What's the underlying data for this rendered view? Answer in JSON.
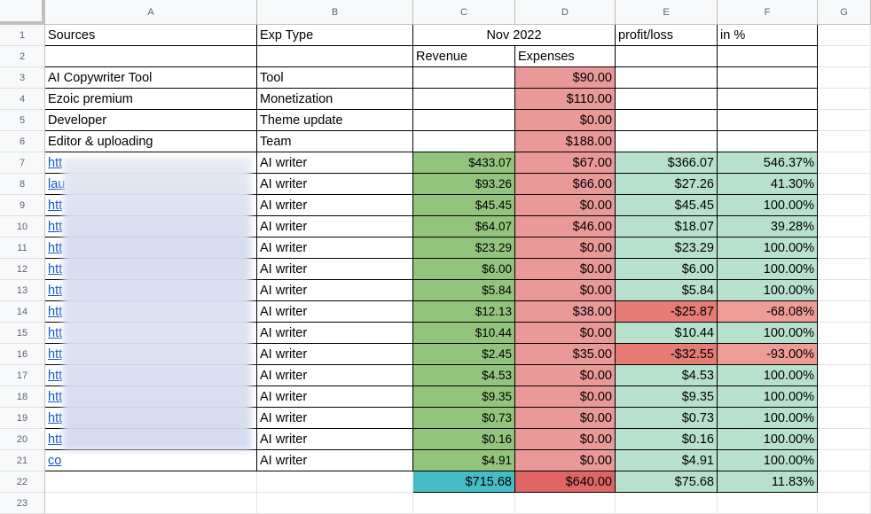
{
  "columns": [
    "A",
    "B",
    "C",
    "D",
    "E",
    "F",
    "G"
  ],
  "row_numbers": [
    "1",
    "2",
    "3",
    "4",
    "5",
    "6",
    "7",
    "8",
    "9",
    "10",
    "11",
    "12",
    "13",
    "14",
    "15",
    "16",
    "17",
    "18",
    "19",
    "20",
    "21",
    "22",
    "23"
  ],
  "header": {
    "sources": "Sources",
    "exp_type": "Exp Type",
    "period": "Nov 2022",
    "profit_loss": "profit/loss",
    "in_pct": "in %",
    "revenue": "Revenue",
    "expenses": "Expenses"
  },
  "rows": [
    {
      "a": "AI Copywriter Tool",
      "b": "Tool",
      "c": "",
      "d": "$90.00",
      "e": "",
      "f": ""
    },
    {
      "a": "Ezoic premium",
      "b": "Monetization",
      "c": "",
      "d": "$110.00",
      "e": "",
      "f": ""
    },
    {
      "a": "Developer",
      "b": "Theme update",
      "c": "",
      "d": "$0.00",
      "e": "",
      "f": ""
    },
    {
      "a": "Editor & uploading",
      "b": "Team",
      "c": "",
      "d": "$188.00",
      "e": "",
      "f": ""
    },
    {
      "a": "htt",
      "b": "AI writer",
      "c": "$433.07",
      "d": "$67.00",
      "e": "$366.07",
      "f": "546.37%"
    },
    {
      "a": "lau",
      "b": "AI writer",
      "c": "$93.26",
      "d": "$66.00",
      "e": "$27.26",
      "f": "41.30%"
    },
    {
      "a": "htt",
      "b": "AI writer",
      "c": "$45.45",
      "d": "$0.00",
      "e": "$45.45",
      "f": "100.00%"
    },
    {
      "a": "htt",
      "b": "AI writer",
      "c": "$64.07",
      "d": "$46.00",
      "e": "$18.07",
      "f": "39.28%"
    },
    {
      "a": "htt",
      "b": "AI writer",
      "c": "$23.29",
      "d": "$0.00",
      "e": "$23.29",
      "f": "100.00%"
    },
    {
      "a": "htt",
      "b": "AI writer",
      "c": "$6.00",
      "d": "$0.00",
      "e": "$6.00",
      "f": "100.00%"
    },
    {
      "a": "htt",
      "b": "AI writer",
      "c": "$5.84",
      "d": "$0.00",
      "e": "$5.84",
      "f": "100.00%"
    },
    {
      "a": "htt",
      "b": "AI writer",
      "c": "$12.13",
      "d": "$38.00",
      "e": "-$25.87",
      "f": "-68.08%"
    },
    {
      "a": "htt",
      "b": "AI writer",
      "c": "$10.44",
      "d": "$0.00",
      "e": "$10.44",
      "f": "100.00%"
    },
    {
      "a": "htt",
      "b": "AI writer",
      "c": "$2.45",
      "d": "$35.00",
      "e": "-$32.55",
      "f": "-93.00%"
    },
    {
      "a": "htt",
      "b": "AI writer",
      "c": "$4.53",
      "d": "$0.00",
      "e": "$4.53",
      "f": "100.00%"
    },
    {
      "a": "htt",
      "b": "AI writer",
      "c": "$9.35",
      "d": "$0.00",
      "e": "$9.35",
      "f": "100.00%"
    },
    {
      "a": "htt",
      "b": "AI writer",
      "c": "$0.73",
      "d": "$0.00",
      "e": "$0.73",
      "f": "100.00%"
    },
    {
      "a": "htt",
      "b": "AI writer",
      "c": "$0.16",
      "d": "$0.00",
      "e": "$0.16",
      "f": "100.00%"
    },
    {
      "a": "co",
      "b": "AI writer",
      "c": "$4.91",
      "d": "$0.00",
      "e": "$4.91",
      "f": "100.00%"
    }
  ],
  "totals": {
    "c": "$715.68",
    "d": "$640.00",
    "e": "$75.68",
    "f": "11.83%"
  },
  "colors": {
    "revenue_fill": "#93c47d",
    "expense_fill": "#ea9999",
    "profit_fill": "#b7e1cd",
    "loss_fill": "#e67c73",
    "loss_pct_fill": "#ee9c96",
    "total_revenue_fill": "#46bdc6",
    "total_expense_fill": "#e06666",
    "link_color": "#1155cc"
  }
}
